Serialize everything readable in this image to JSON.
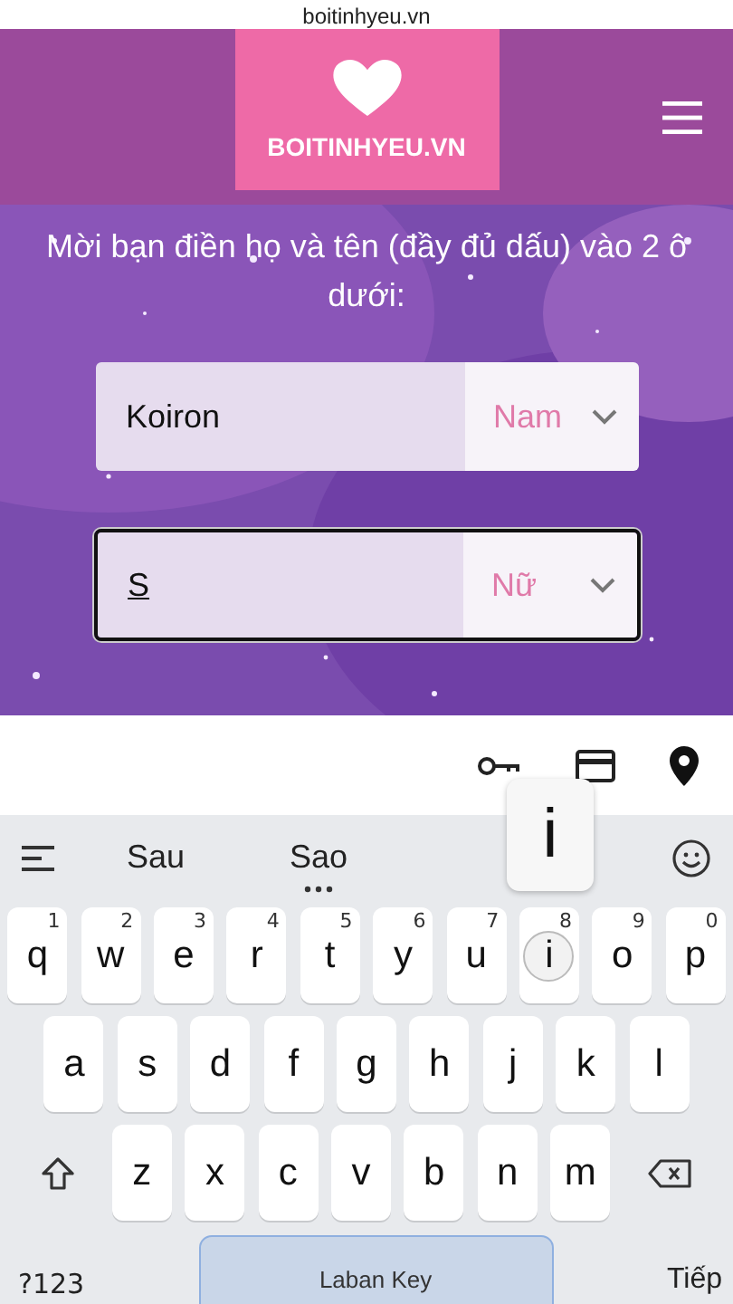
{
  "browser": {
    "url": "boitinhyeu.vn"
  },
  "header": {
    "logo_text": "BOITINHYEU.VN"
  },
  "hero": {
    "kind": "picture",
    "heading": "Mời bạn điền họ và tên (đầy đủ dấu) vào 2 ô dưới:"
  },
  "forms": [
    {
      "value": "Koiron",
      "gender": "Nam",
      "focused": false,
      "composing": false
    },
    {
      "value": "S",
      "gender": "Nữ",
      "focused": true,
      "composing": true
    }
  ],
  "keyboard": {
    "suggestions": [
      {
        "text": "Sau",
        "more": false
      },
      {
        "text": "Sao",
        "more": true
      }
    ],
    "key_popup": "i",
    "rows": [
      [
        {
          "kind": "letter",
          "label": "q",
          "hint": "1",
          "pressed": false
        },
        {
          "kind": "letter",
          "label": "w",
          "hint": "2",
          "pressed": false
        },
        {
          "kind": "letter",
          "label": "e",
          "hint": "3",
          "pressed": false
        },
        {
          "kind": "letter",
          "label": "r",
          "hint": "4",
          "pressed": false
        },
        {
          "kind": "letter",
          "label": "t",
          "hint": "5",
          "pressed": false
        },
        {
          "kind": "letter",
          "label": "y",
          "hint": "6",
          "pressed": false
        },
        {
          "kind": "letter",
          "label": "u",
          "hint": "7",
          "pressed": false
        },
        {
          "kind": "letter",
          "label": "i",
          "hint": "8",
          "pressed": true
        },
        {
          "kind": "letter",
          "label": "o",
          "hint": "9",
          "pressed": false
        },
        {
          "kind": "letter",
          "label": "p",
          "hint": "0",
          "pressed": false
        }
      ],
      [
        {
          "kind": "letter",
          "label": "a",
          "pressed": false
        },
        {
          "kind": "letter",
          "label": "s",
          "pressed": false
        },
        {
          "kind": "letter",
          "label": "d",
          "pressed": false
        },
        {
          "kind": "letter",
          "label": "f",
          "pressed": false
        },
        {
          "kind": "letter",
          "label": "g",
          "pressed": false
        },
        {
          "kind": "letter",
          "label": "h",
          "pressed": false
        },
        {
          "kind": "letter",
          "label": "j",
          "pressed": false
        },
        {
          "kind": "letter",
          "label": "k",
          "pressed": false
        },
        {
          "kind": "letter",
          "label": "l",
          "pressed": false
        }
      ],
      [
        {
          "kind": "shift",
          "pressed": false
        },
        {
          "kind": "letter",
          "label": "z",
          "pressed": false
        },
        {
          "kind": "letter",
          "label": "x",
          "pressed": false
        },
        {
          "kind": "letter",
          "label": "c",
          "pressed": false
        },
        {
          "kind": "letter",
          "label": "v",
          "pressed": false
        },
        {
          "kind": "letter",
          "label": "b",
          "pressed": false
        },
        {
          "kind": "letter",
          "label": "n",
          "pressed": false
        },
        {
          "kind": "letter",
          "label": "m",
          "pressed": false
        },
        {
          "kind": "backspace",
          "pressed": false
        }
      ]
    ],
    "bottom": {
      "symbols": "?123",
      "space": "Laban Key",
      "enter": "Tiếp"
    }
  }
}
